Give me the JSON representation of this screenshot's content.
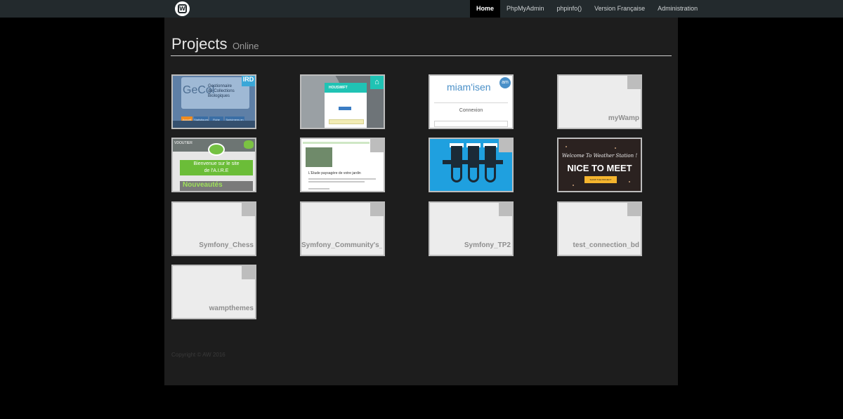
{
  "nav": {
    "logo_text": "W",
    "items": [
      {
        "label": "Home",
        "active": true
      },
      {
        "label": "PhpMyAdmin"
      },
      {
        "label": "phpinfo()"
      },
      {
        "label": "Version Française"
      },
      {
        "label": "Administration"
      }
    ]
  },
  "page": {
    "title": "Projects",
    "subtitle": "Online"
  },
  "projects": [
    {
      "thumb": "gecol",
      "thumb_text": {
        "big": "GeCol",
        "desc1": "Gestionnaire",
        "desc2": "de Collections Biologiques",
        "badge": "IRD",
        "tabs": [
          "Accueil",
          "Statistiques",
          "Fiche Saisie",
          "Spécimens en collection"
        ]
      }
    },
    {
      "thumb": "houswift",
      "thumb_text": {
        "brand": "HOUSWIFT"
      }
    },
    {
      "thumb": "miamisen",
      "thumb_text": {
        "logo": "miam'isen",
        "badge": "am",
        "heading": "Connexion"
      }
    },
    {
      "thumb": "none",
      "label": "myWamp"
    },
    {
      "thumb": "aire",
      "thumb_text": {
        "top": "VDOUTIER",
        "banner1": "Bienvenue sur le site",
        "banner2": "de l'A.I.R.E",
        "news": "Nouveautés"
      }
    },
    {
      "thumb": "etude",
      "thumb_text": {
        "title": "L'Etude paysagère de votre jardin"
      }
    },
    {
      "thumb": "tubes"
    },
    {
      "thumb": "weather",
      "thumb_text": {
        "line1": "Welcome To Weather Station !",
        "line2": "NICE TO MEET",
        "button": "SHOW THE PROJECT"
      }
    },
    {
      "thumb": "none",
      "label": "Symfony_Chess"
    },
    {
      "thumb": "none",
      "label": "Symfony_Community's_l"
    },
    {
      "thumb": "none",
      "label": "Symfony_TP2"
    },
    {
      "thumb": "none",
      "label": "test_connection_bd"
    },
    {
      "thumb": "none",
      "label": "wampthemes"
    }
  ],
  "footer": {
    "copyright": "Copyright © AW 2016"
  },
  "colors": {
    "page_bg": "#000000",
    "content_bg": "#1d1d1d",
    "topbar_bg": "#232a2d",
    "tile_bg": "#ececec",
    "tile_border": "#bdbdbd"
  }
}
